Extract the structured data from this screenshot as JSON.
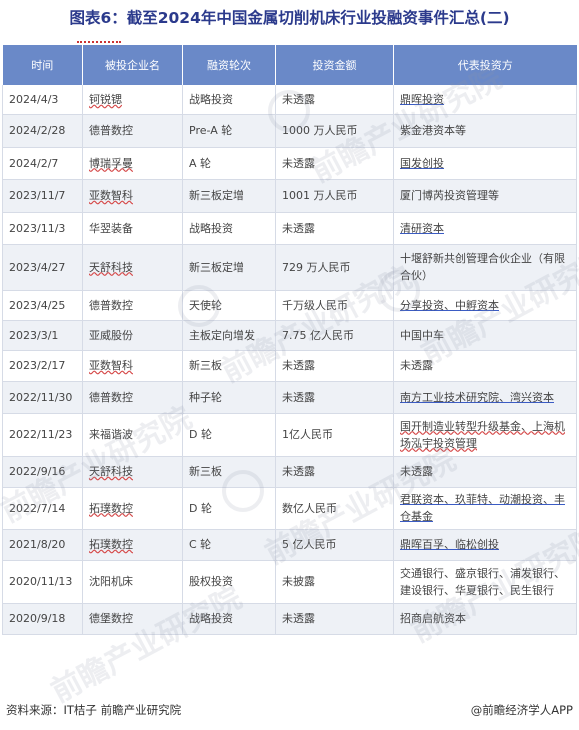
{
  "title": "图表6：截至2024年中国金属切削机床行业投融资事件汇总(二)",
  "table": {
    "headers": [
      "时间",
      "被投企业名",
      "融资轮次",
      "投资金额",
      "代表投资方"
    ],
    "rows": [
      [
        "2024/4/3",
        "钶锐锶",
        "战略投资",
        "未透露",
        "鼎晖投资"
      ],
      [
        "2024/2/28",
        "德普数控",
        "Pre-A 轮",
        "1000 万人民币",
        "紫金港资本等"
      ],
      [
        "2024/2/7",
        "博瑞孚曼",
        "A 轮",
        "未透露",
        "国发创投"
      ],
      [
        "2023/11/7",
        "亚数智科",
        "新三板定增",
        "1001 万人民币",
        "厦门博芮投资管理等"
      ],
      [
        "2023/11/3",
        "华翌装备",
        "战略投资",
        "未透露",
        "清研资本"
      ],
      [
        "2023/4/27",
        "天舒科技",
        "新三板定增",
        "729 万人民币",
        "十堰舒新共创管理合伙企业（有限合伙）"
      ],
      [
        "2023/4/25",
        "德普数控",
        "天使轮",
        "千万级人民币",
        "分享投资、中孵资本"
      ],
      [
        "2023/3/1",
        "亚威股份",
        "主板定向增发",
        "7.75 亿人民币",
        "中国中车"
      ],
      [
        "2023/2/17",
        "亚数智科",
        "新三板",
        "未透露",
        "未透露"
      ],
      [
        "2022/11/30",
        "德普数控",
        "种子轮",
        "未透露",
        "南方工业技术研究院、湾兴资本"
      ],
      [
        "2022/11/23",
        "来福谐波",
        "D 轮",
        "1亿人民币",
        "国开制造业转型升级基金、上海机场泓宇投资管理"
      ],
      [
        "2022/9/16",
        "天舒科技",
        "新三板",
        "未透露",
        "未透露"
      ],
      [
        "2022/7/14",
        "拓璞数控",
        "D 轮",
        "数亿人民币",
        "君联资本、玖菲特、动潮投资、丰仓基金"
      ],
      [
        "2021/8/20",
        "拓璞数控",
        "C 轮",
        "5 亿人民币",
        "鼎晖百孚、临松创投"
      ],
      [
        "2020/11/13",
        "沈阳机床",
        "股权投资",
        "未披露",
        "交通银行、盛京银行、浦发银行、建设银行、华夏银行、民生银行"
      ],
      [
        "2020/9/18",
        "德堡数控",
        "战略投资",
        "未透露",
        "招商启航资本"
      ]
    ]
  },
  "watermark": "前瞻产业研究院",
  "footer": {
    "source": "资料来源：IT桔子 前瞻产业研究院",
    "brand": "@前瞻经济学人APP"
  }
}
